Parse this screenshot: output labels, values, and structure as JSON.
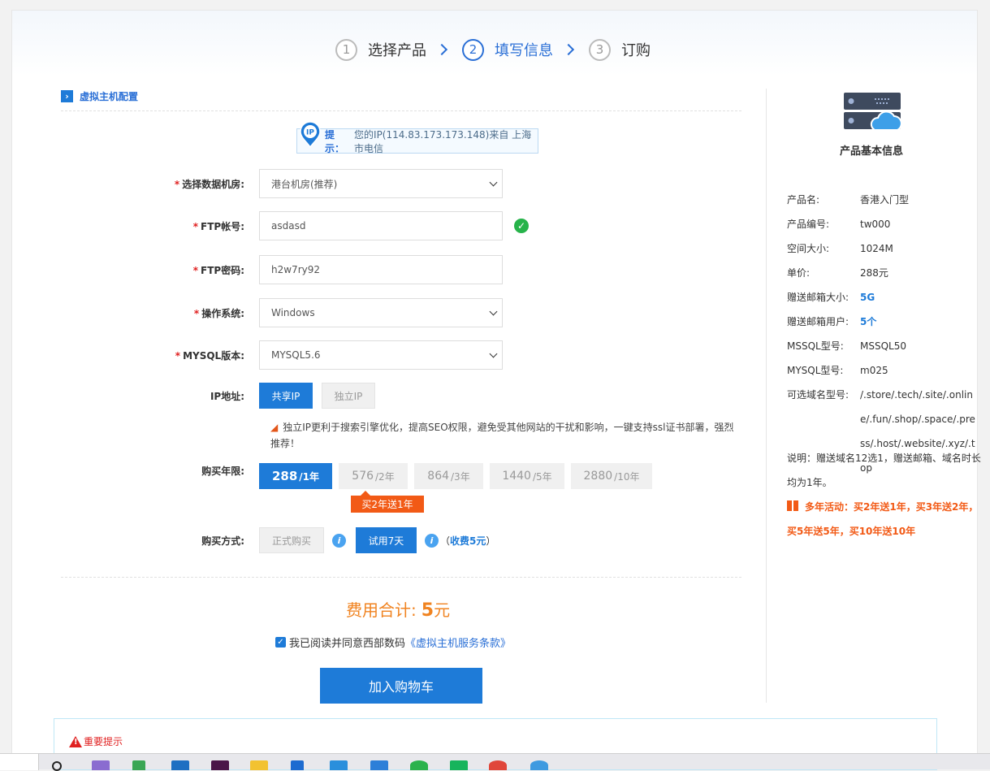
{
  "steps": [
    {
      "num": "1",
      "label": "选择产品"
    },
    {
      "num": "2",
      "label": "填写信息"
    },
    {
      "num": "3",
      "label": "订购"
    }
  ],
  "section_title": "虚拟主机配置",
  "tip": {
    "label": "提示：",
    "text": "您的IP(114.83.173.173.148)来自 上海市电信"
  },
  "form": {
    "datacenter": {
      "label": "选择数据机房:",
      "value": "港台机房(推荐)"
    },
    "ftp_account": {
      "label": "FTP帐号:",
      "value": "asdasd"
    },
    "ftp_password": {
      "label": "FTP密码:",
      "value": "h2w7ry92"
    },
    "os": {
      "label": "操作系统:",
      "value": "Windows"
    },
    "mysql": {
      "label": "MYSQL版本:",
      "value": "MYSQL5.6"
    },
    "ip": {
      "label": "IP地址:",
      "options": [
        "共享IP",
        "独立IP"
      ]
    },
    "ip_note": "独立IP更利于搜索引擎优化，提高SEO权限，避免受其他网站的干扰和影响，一键支持ssl证书部署，强烈推荐！",
    "years": {
      "label": "购买年限:",
      "options": [
        {
          "price": "288",
          "unit": "/1年"
        },
        {
          "price": "576",
          "unit": "/2年"
        },
        {
          "price": "864",
          "unit": "/3年"
        },
        {
          "price": "1440",
          "unit": "/5年"
        },
        {
          "price": "2880",
          "unit": "/10年"
        }
      ],
      "promo_tag": "买2年送1年"
    },
    "purchase": {
      "label": "购买方式:",
      "formal": "正式购买",
      "trial": "试用7天",
      "fee_open": "（",
      "fee": "收费5元",
      "fee_close": "）"
    }
  },
  "total": {
    "label": "费用合计:",
    "amount": "5",
    "unit": "元"
  },
  "agree": {
    "text": "我已阅读并同意西部数码",
    "link": "《虚拟主机服务条款》"
  },
  "cart_button": "加入购物车",
  "panel": {
    "title": "产品基本信息",
    "rows": [
      {
        "k": "产品名:",
        "v": "香港入门型"
      },
      {
        "k": "产品编号:",
        "v": "tw000"
      },
      {
        "k": "空间大小:",
        "v": "1024M"
      },
      {
        "k": "单价:",
        "v": "288元"
      },
      {
        "k": "赠送邮箱大小:",
        "v": "5G"
      },
      {
        "k": "赠送邮箱用户:",
        "v": "5个"
      },
      {
        "k": "MSSQL型号:",
        "v": "MSSQL50"
      },
      {
        "k": "MYSQL型号:",
        "v": "m025"
      },
      {
        "k": "可选域名型号:",
        "v": "/.store/.tech/.site/.online/.fun/.shop/.space/.press/.host/.website/.xyz/.top"
      }
    ],
    "explain": "说明：赠送域名12选1，赠送邮箱、域名时长均为1年。",
    "promo": "多年活动：买2年送1年，买3年送2年，买5年送5年，买10年送10年"
  },
  "notice_title": "重要提示",
  "colors": {
    "primary": "#1e7bd8",
    "accent": "#f25a16",
    "success": "#27b34a"
  }
}
